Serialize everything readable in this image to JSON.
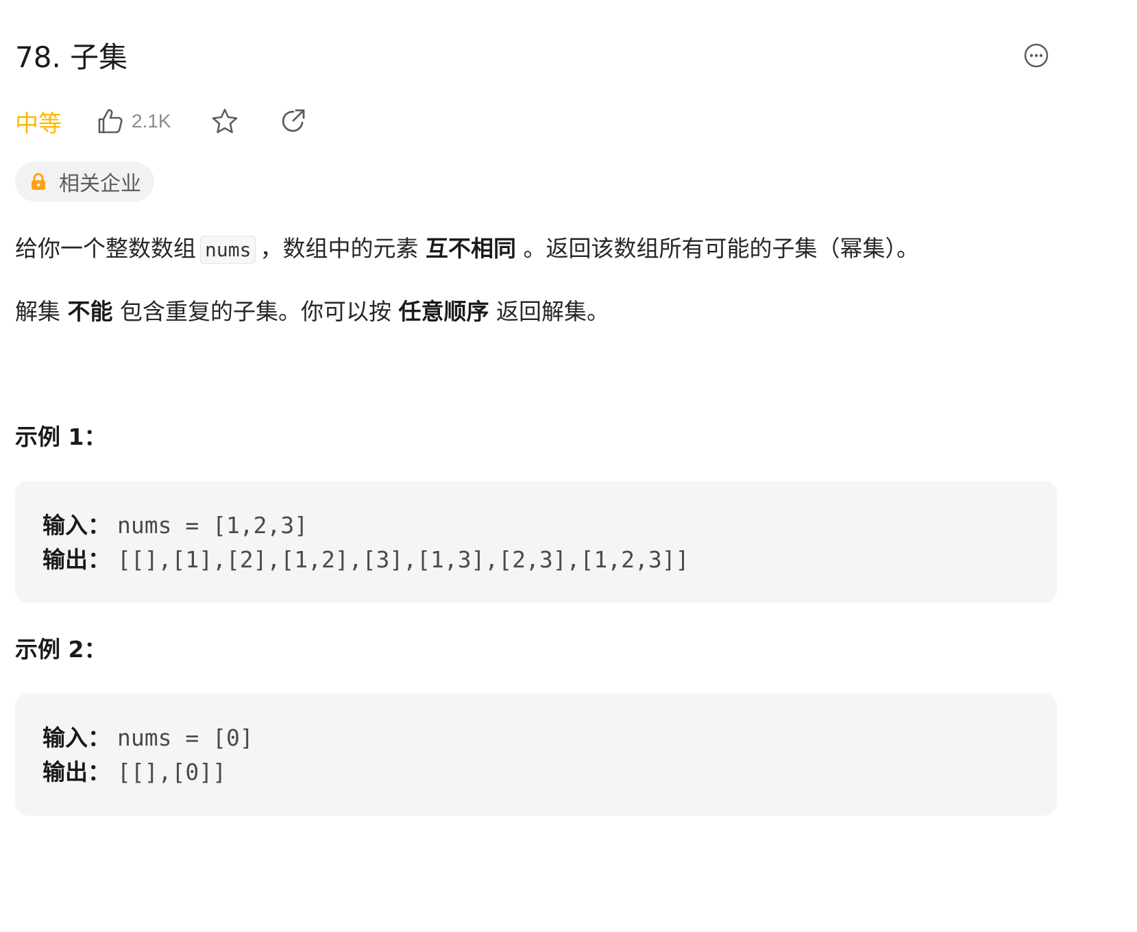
{
  "problem": {
    "title": "78. 子集",
    "difficulty": "中等",
    "like_count": "2.1K",
    "company_tag": "相关企业"
  },
  "description": {
    "p1_a": "给你一个整数数组",
    "p1_code": "nums",
    "p1_b": "，数组中的元素",
    "p1_bold": "互不相同",
    "p1_c": "。返回该数组所有可能的子集（幂集）。",
    "p2_a": "解集",
    "p2_bold1": "不能",
    "p2_b": "包含重复的子集。你可以按",
    "p2_bold2": "任意顺序",
    "p2_c": "返回解集。"
  },
  "examples": [
    {
      "heading": "示例 1：",
      "input_label": "输入：",
      "input_value": "nums = [1,2,3]",
      "output_label": "输出：",
      "output_value": "[[],[1],[2],[1,2],[3],[1,3],[2,3],[1,2,3]]"
    },
    {
      "heading": "示例 2：",
      "input_label": "输入：",
      "input_value": "nums = [0]",
      "output_label": "输出：",
      "output_value": "[[],[0]]"
    }
  ],
  "colors": {
    "difficulty_medium": "#ffb800",
    "lock_icon": "#ffa116",
    "example_bg": "#f5f5f5"
  },
  "icons": [
    "more-icon",
    "thumbs-up-icon",
    "star-icon",
    "share-icon",
    "lock-icon"
  ]
}
